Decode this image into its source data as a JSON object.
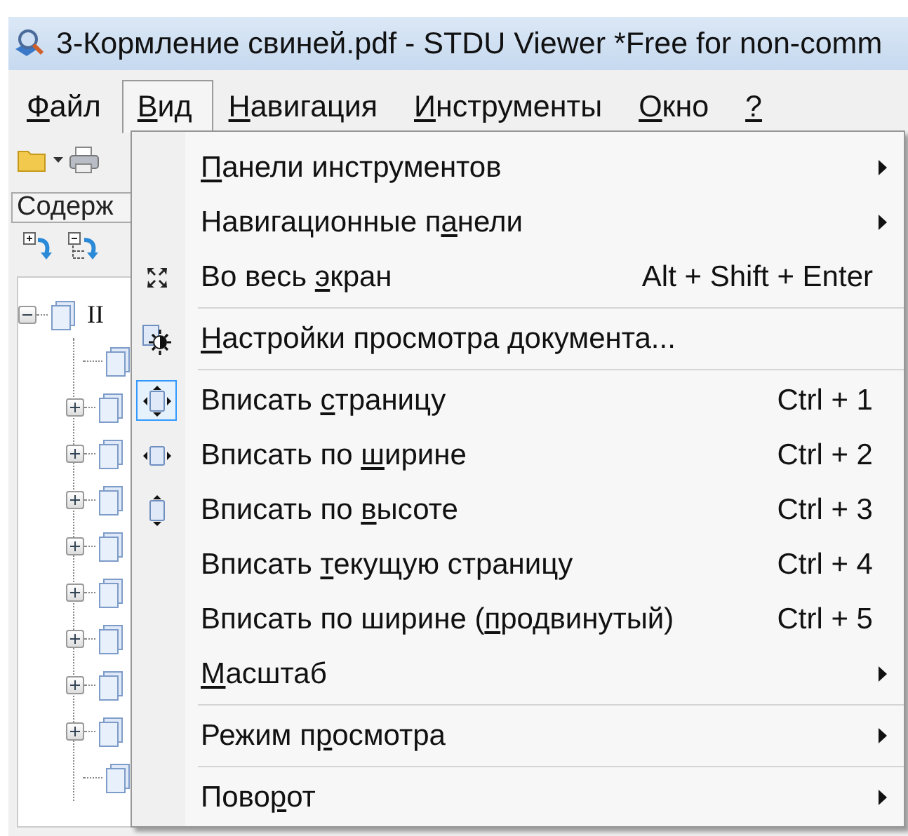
{
  "window": {
    "title": "3-Кормление свиней.pdf - STDU Viewer *Free for non-comm"
  },
  "menu_bar": [
    {
      "label_parts": {
        "key": "Ф",
        "after": "айл"
      },
      "selected": false
    },
    {
      "label_parts": {
        "key": "В",
        "after": "ид"
      },
      "selected": true
    },
    {
      "label_parts": {
        "key": "Н",
        "after": "авигация"
      },
      "selected": false
    },
    {
      "label_parts": {
        "key": "И",
        "after": "нструменты"
      },
      "selected": false
    },
    {
      "label_parts": {
        "key": "О",
        "after": "кно"
      },
      "selected": false
    },
    {
      "label_parts": {
        "key": "?"
      },
      "selected": false
    }
  ],
  "side_panel": {
    "tab": "Содерж",
    "tree": [
      {
        "label": "II",
        "kind": "node",
        "expanded": true,
        "children": [
          {
            "kind": "leaf"
          },
          {
            "kind": "node",
            "expanded": false
          },
          {
            "kind": "node",
            "expanded": false
          },
          {
            "kind": "node",
            "expanded": false
          },
          {
            "kind": "node",
            "expanded": false
          },
          {
            "kind": "node",
            "expanded": false
          },
          {
            "kind": "node",
            "expanded": false
          },
          {
            "kind": "node",
            "expanded": false
          },
          {
            "kind": "node",
            "expanded": false
          },
          {
            "kind": "leaf"
          }
        ]
      }
    ]
  },
  "view_menu": {
    "groups": [
      [
        {
          "label_parts": {
            "key": "П",
            "after": "анели инструментов"
          },
          "submenu": true,
          "checked": false
        },
        {
          "label_parts": {
            "before": "Навигационные п",
            "key": "а",
            "after": "нели"
          },
          "submenu": true,
          "checked": false
        },
        {
          "label_parts": {
            "before": "Во весь ",
            "key": "э",
            "after": "кран"
          },
          "shortcut": "Alt + Shift + Enter",
          "submenu": false,
          "checked": false
        }
      ],
      [
        {
          "label_parts": {
            "key": "Н",
            "after": "астройки просмотра документа..."
          },
          "submenu": false,
          "checked": false
        }
      ],
      [
        {
          "label_parts": {
            "before": "Вписать ",
            "key": "с",
            "after": "траницу"
          },
          "shortcut": "Ctrl + 1",
          "submenu": false,
          "checked": true
        },
        {
          "label_parts": {
            "before": "Вписать по ",
            "key": "ш",
            "after": "ирине"
          },
          "shortcut": "Ctrl + 2",
          "submenu": false,
          "checked": false
        },
        {
          "label_parts": {
            "before": "Вписать по ",
            "key": "в",
            "after": "ысоте"
          },
          "shortcut": "Ctrl + 3",
          "submenu": false,
          "checked": false
        },
        {
          "label_parts": {
            "before": "Вписать ",
            "key": "т",
            "after": "екущую страницу"
          },
          "shortcut": "Ctrl + 4",
          "submenu": false,
          "checked": false
        },
        {
          "label_parts": {
            "before": "Вписать по ширине (",
            "key": "п",
            "after": "родвинутый)"
          },
          "shortcut": "Ctrl + 5",
          "submenu": false,
          "checked": false
        },
        {
          "label_parts": {
            "key": "М",
            "after": "асштаб"
          },
          "submenu": true,
          "checked": false
        }
      ],
      [
        {
          "label_parts": {
            "before": "Режим п",
            "key": "р",
            "after": "осмотра"
          },
          "submenu": true,
          "checked": false
        }
      ],
      [
        {
          "label_parts": {
            "before": "Пово",
            "key": "р",
            "after": "от"
          },
          "submenu": true,
          "checked": false
        }
      ]
    ]
  }
}
